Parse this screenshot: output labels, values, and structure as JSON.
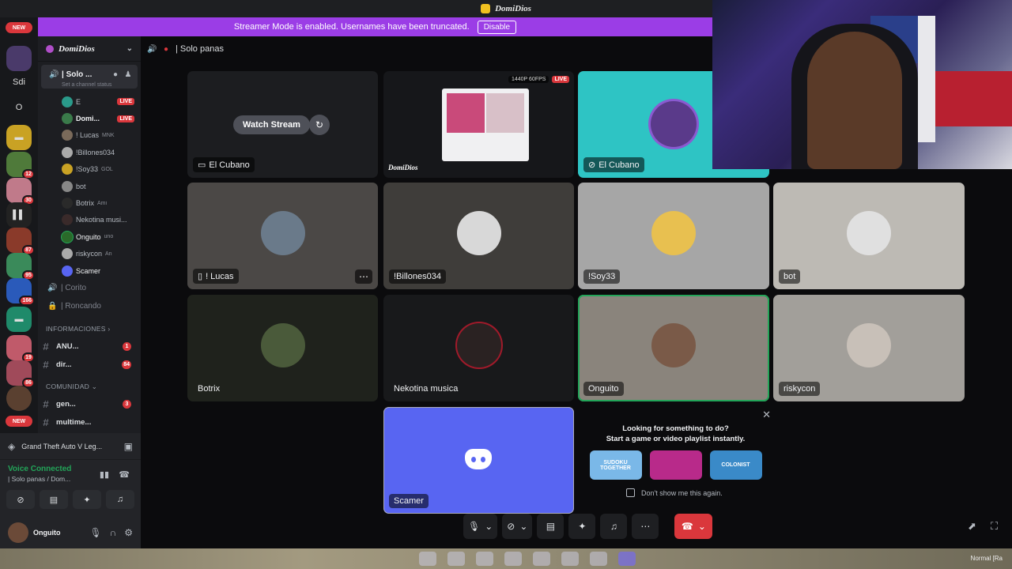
{
  "title_bar": {
    "server_name": "DomiDios"
  },
  "banner": {
    "text": "Streamer Mode is enabled. Usernames have been truncated.",
    "button": "Disable"
  },
  "rail": {
    "new_top": "NEW",
    "new_bottom": "NEW",
    "items": [
      {
        "label": "Sdi"
      },
      {
        "label": "O"
      }
    ],
    "badges": [
      "12",
      "30",
      "87",
      "95",
      "166",
      "19",
      "86"
    ]
  },
  "sidebar": {
    "server_name": "DomiDios",
    "current_channel": "| Solo ...",
    "channel_status_placeholder": "Set a channel status",
    "members": [
      {
        "name": "E",
        "live": "LIVE",
        "extra": ""
      },
      {
        "name": "Domi...",
        "live": "LIVE",
        "extra": ""
      },
      {
        "name": "! Lucas",
        "live": "",
        "extra": "MNK"
      },
      {
        "name": "!Billones034",
        "live": "",
        "extra": ""
      },
      {
        "name": "!Soy33",
        "live": "",
        "extra": "GOL"
      },
      {
        "name": "bot",
        "live": "",
        "extra": ""
      },
      {
        "name": "Botrix",
        "live": "",
        "extra": "Ami"
      },
      {
        "name": "Nekotina musi...",
        "live": "",
        "extra": ""
      },
      {
        "name": "Onguito",
        "live": "",
        "extra": "uno"
      },
      {
        "name": "riskycon",
        "live": "",
        "extra": "An"
      },
      {
        "name": "Scamer",
        "live": "",
        "extra": ""
      }
    ],
    "voice_channels": [
      {
        "name": "| Corito"
      },
      {
        "name": "| Roncando"
      }
    ],
    "categories": {
      "info": "INFORMACIONES",
      "community": "COMUNIDAD"
    },
    "text_channels_info": [
      {
        "name": "ANU...",
        "badge": "1"
      },
      {
        "name": "dir...",
        "badge": "84"
      }
    ],
    "text_channels_community": [
      {
        "name": "gen...",
        "badge": "3"
      },
      {
        "name": "multime...",
        "badge": ""
      }
    ]
  },
  "bottom_panel": {
    "activity": "Grand Theft Auto V Leg...",
    "voice_connected": "Voice Connected",
    "voice_location": "| Solo panas / Dom...",
    "username": "Onguito"
  },
  "main": {
    "header_channel": "| Solo panas",
    "watch_stream": "Watch Stream",
    "stream_quality": "1440P 60FPS",
    "stream_live": "LIVE",
    "tiles": [
      {
        "label": "El Cubano"
      },
      {
        "label": "DomiDios"
      },
      {
        "label": "El Cubano"
      },
      {
        "label": "! Lucas"
      },
      {
        "label": "!Billones034"
      },
      {
        "label": "!Soy33"
      },
      {
        "label": "bot"
      },
      {
        "label": "Botrix"
      },
      {
        "label": "Nekotina musica"
      },
      {
        "label": "Onguito"
      },
      {
        "label": "riskycon"
      },
      {
        "label": "Scamer"
      }
    ],
    "suggestion": {
      "line1": "Looking for something to do?",
      "line2": "Start a game or video playlist instantly.",
      "games": [
        "SUDOKU TOGETHER",
        "",
        "COLONIST"
      ],
      "checkbox": "Don't show me this again."
    }
  },
  "desktop": {
    "corner_text": "Normal [Ra"
  },
  "colors": {
    "accent": "#5865f2",
    "live": "#da373c",
    "speaking": "#23a559",
    "banner": "#9b3de6"
  }
}
